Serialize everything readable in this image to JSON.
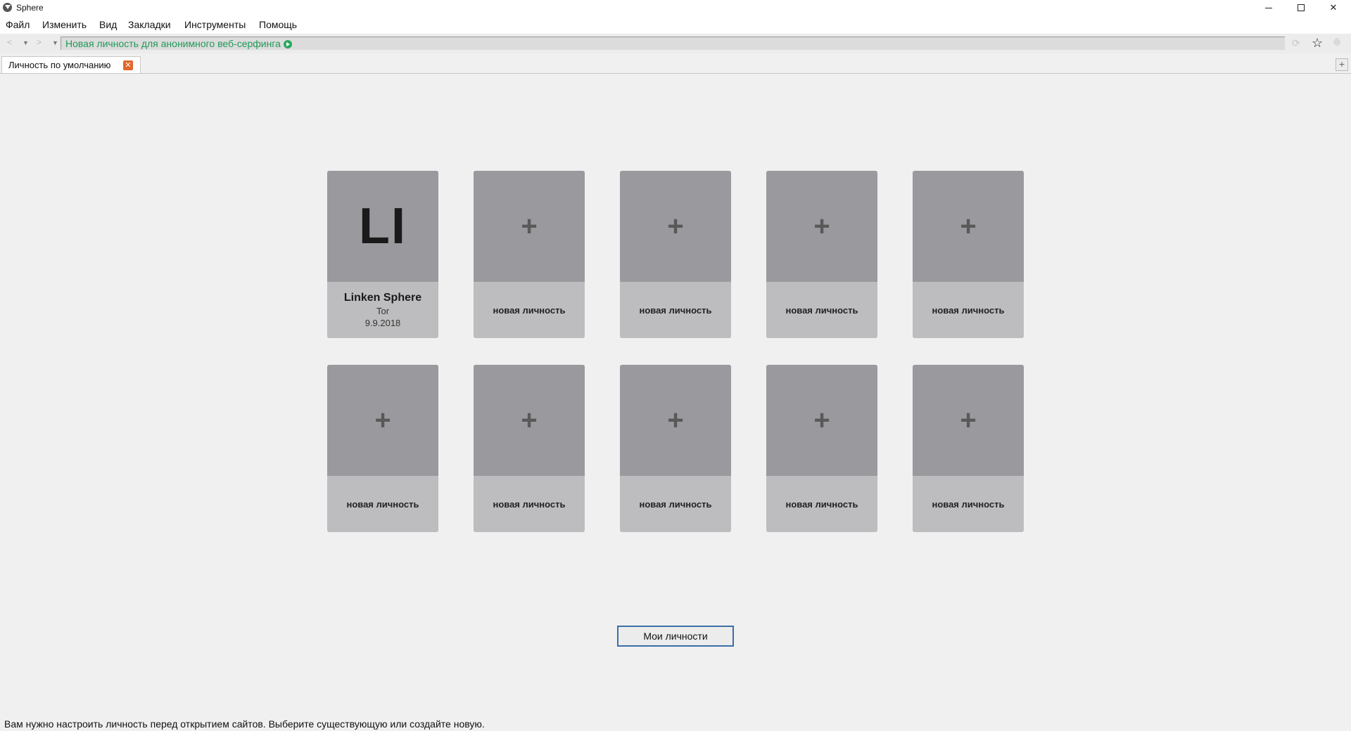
{
  "window": {
    "title": "Sphere",
    "controls": {
      "minimize": "minimize-icon",
      "maximize": "restore-icon",
      "close": "close-icon"
    }
  },
  "menu": [
    "Файл",
    "Изменить",
    "Вид",
    "Закладки",
    "Инструменты",
    "Помощь"
  ],
  "address_bar": {
    "text": "Новая личность для анонимного веб-серфинга",
    "color": "#1f9a58"
  },
  "tabs": [
    {
      "label": "Личность по умолчанию"
    }
  ],
  "profiles": {
    "existing": {
      "initials": "LI",
      "name": "Linken Sphere",
      "type": "Tor",
      "date": "9.9.2018"
    },
    "new_label": "новая личность"
  },
  "my_profiles_button": "Мои личности",
  "status_text": "Вам нужно настроить личность перед открытием сайтов. Выберите существующую или создайте новую."
}
